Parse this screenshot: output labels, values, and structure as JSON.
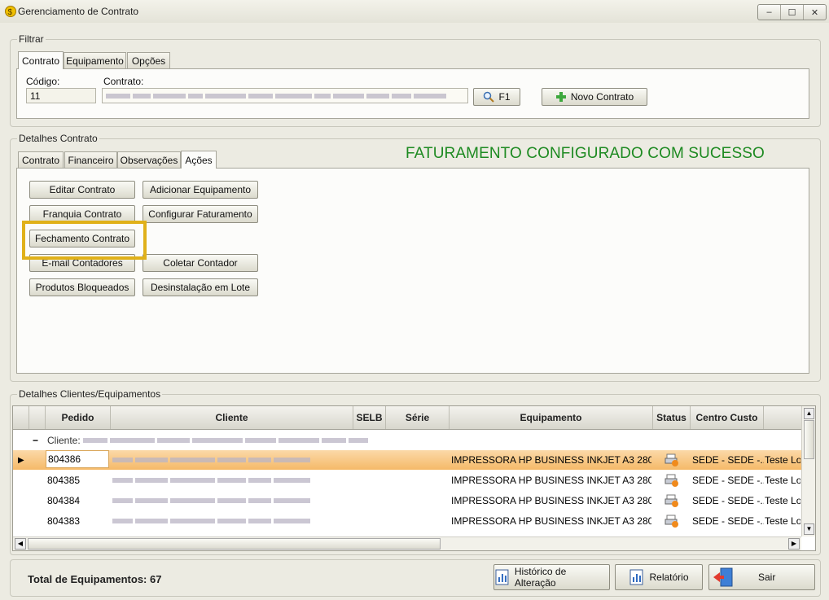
{
  "window": {
    "title": "Gerenciamento de Contrato",
    "controls": [
      "‒",
      "☐",
      "✕"
    ]
  },
  "filtrar": {
    "legend": "Filtrar",
    "tabs": [
      "Contrato",
      "Equipamento",
      "Opções"
    ],
    "codigo_label": "Código:",
    "codigo_value": "11",
    "contrato_label": "Contrato:",
    "search_button": "F1",
    "novo_contrato_button": "Novo Contrato"
  },
  "detalhes": {
    "legend": "Detalhes Contrato",
    "tabs": [
      "Contrato",
      "Financeiro",
      "Observações",
      "Ações"
    ],
    "message": "FATURAMENTO CONFIGURADO COM SUCESSO",
    "buttons": {
      "editar": "Editar Contrato",
      "adicionar": "Adicionar Equipamento",
      "franquia": "Franquia Contrato",
      "configurar": "Configurar Faturamento",
      "fechamento": "Fechamento Contrato",
      "email": "E-mail Contadores",
      "coletar": "Coletar Contador",
      "produtos": "Produtos Bloqueados",
      "desinstalacao": "Desinstalação em Lote"
    }
  },
  "clientes": {
    "legend": "Detalhes Clientes/Equipamentos",
    "columns": [
      "Pedido",
      "Cliente",
      "SELB",
      "Série",
      "Equipamento",
      "Status",
      "Centro Custo"
    ],
    "group_label": "Cliente:",
    "rows": [
      {
        "pedido": "804386",
        "equipamento": "IMPRESSORA HP BUSINESS INKJET A3 280...",
        "centro": "SEDE - SEDE -...",
        "extra": "Teste Lo"
      },
      {
        "pedido": "804385",
        "equipamento": "IMPRESSORA HP BUSINESS INKJET A3 280...",
        "centro": "SEDE - SEDE -...",
        "extra": "Teste Lo"
      },
      {
        "pedido": "804384",
        "equipamento": "IMPRESSORA HP BUSINESS INKJET A3 280...",
        "centro": "SEDE - SEDE -...",
        "extra": "Teste Lo"
      },
      {
        "pedido": "804383",
        "equipamento": "IMPRESSORA HP BUSINESS INKJET A3 280...",
        "centro": "SEDE - SEDE -...",
        "extra": "Teste Lo"
      }
    ]
  },
  "footer": {
    "total": "Total de Equipamentos: 67",
    "historico": "Histórico de Alteração",
    "relatorio": "Relatório",
    "sair": "Sair"
  },
  "colors": {
    "success": "#1d8a21",
    "highlight": "#e0b11a",
    "selected_row": "#f7c27a"
  }
}
